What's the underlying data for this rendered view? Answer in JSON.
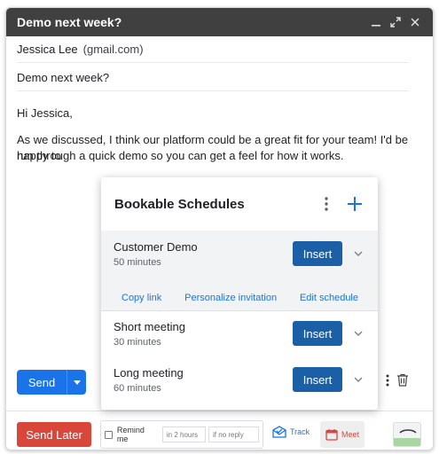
{
  "compose": {
    "title": "Demo next week?",
    "to_name": "Jessica Lee",
    "to_email": "(gmail.com)",
    "subject": "Demo next week?",
    "greeting": "Hi Jessica,",
    "body_line1": "As we discussed, I think our platform could be a great fit for your team! I'd be happy to",
    "body_line2": "run through a quick demo so you can get a feel for how it works."
  },
  "toolbar": {
    "send_label": "Send"
  },
  "bottombar": {
    "send_later_label": "Send Later",
    "remind_label": "Remind me",
    "remind_hours_placeholder": "in 2 hours",
    "remind_reply_placeholder": "if no reply",
    "track_label": "Track",
    "meet_label": "Meet"
  },
  "popup": {
    "title": "Bookable Schedules",
    "schedules": [
      {
        "name": "Customer Demo",
        "duration": "50 minutes",
        "insert_label": "Insert",
        "expanded": true
      },
      {
        "name": "Short meeting",
        "duration": "30 minutes",
        "insert_label": "Insert",
        "expanded": false
      },
      {
        "name": "Long meeting",
        "duration": "60 minutes",
        "insert_label": "Insert",
        "expanded": false
      }
    ],
    "links": {
      "copy": "Copy link",
      "personalize": "Personalize invitation",
      "edit": "Edit schedule"
    }
  },
  "colors": {
    "titlebar": "#404040",
    "send": "#1a73e8",
    "send_later": "#d9473b",
    "insert": "#1b5fa6",
    "link": "#1a73e8"
  },
  "icons": [
    "minimize-icon",
    "expand-icon",
    "close-icon",
    "more-vert-icon",
    "plus-icon",
    "chevron-down-icon",
    "trash-icon",
    "track-icon",
    "calendar-icon"
  ]
}
